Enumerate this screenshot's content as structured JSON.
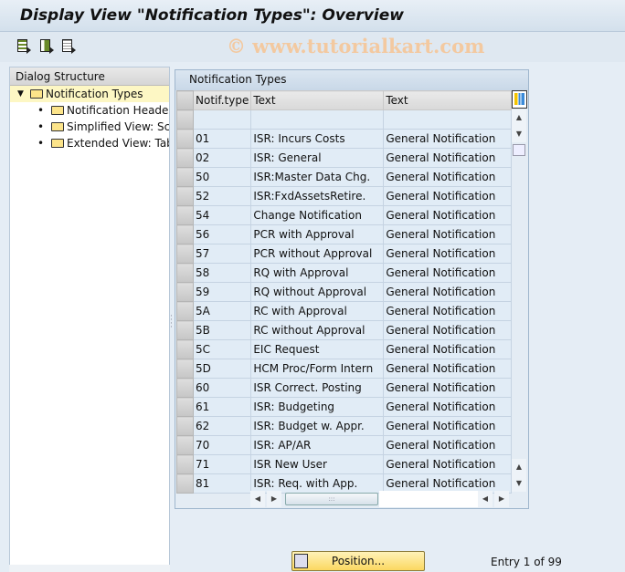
{
  "title": "Display View \"Notification Types\": Overview",
  "toolbar": {
    "icons": [
      "select-all-icon",
      "select-block-icon",
      "deselect-all-icon"
    ]
  },
  "watermark": "© www.tutorialkart.com",
  "dialog": {
    "header": "Dialog Structure",
    "items": [
      {
        "label": "Notification Types",
        "selected": true
      },
      {
        "label": "Notification Header a"
      },
      {
        "label": "Simplified View: Scre"
      },
      {
        "label": "Extended View: Tab"
      }
    ]
  },
  "table": {
    "title": "Notification Types",
    "columns": [
      "Notif.type",
      "Text",
      "Text"
    ],
    "rows": [
      [
        "01",
        "ISR: Incurs Costs",
        "General Notification"
      ],
      [
        "02",
        "ISR: General",
        "General Notification"
      ],
      [
        "50",
        "ISR:Master Data Chg.",
        "General Notification"
      ],
      [
        "52",
        "ISR:FxdAssetsRetire.",
        "General Notification"
      ],
      [
        "54",
        "Change Notification",
        "General Notification"
      ],
      [
        "56",
        "PCR with Approval",
        "General Notification"
      ],
      [
        "57",
        "PCR without Approval",
        "General Notification"
      ],
      [
        "58",
        "RQ with Approval",
        "General Notification"
      ],
      [
        "59",
        "RQ without Approval",
        "General Notification"
      ],
      [
        "5A",
        "RC with Approval",
        "General Notification"
      ],
      [
        "5B",
        "RC without Approval",
        "General Notification"
      ],
      [
        "5C",
        "EIC Request",
        "General Notification"
      ],
      [
        "5D",
        "HCM Proc/Form Intern",
        "General Notification"
      ],
      [
        "60",
        "ISR Correct. Posting",
        "General Notification"
      ],
      [
        "61",
        "ISR: Budgeting",
        "General Notification"
      ],
      [
        "62",
        "ISR: Budget w. Appr.",
        "General Notification"
      ],
      [
        "70",
        "ISR: AP/AR",
        "General Notification"
      ],
      [
        "71",
        "ISR New User",
        "General Notification"
      ],
      [
        "81",
        "ISR: Req. with App.",
        "General Notification"
      ]
    ]
  },
  "footer": {
    "position_label": "Position...",
    "entry": "Entry 1 of 99"
  }
}
